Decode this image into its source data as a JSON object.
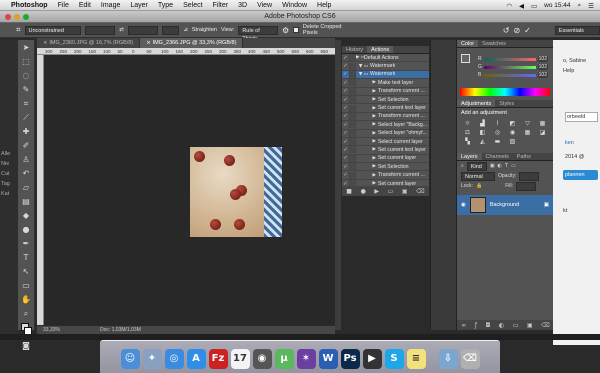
{
  "menubar": {
    "app": "Photoshop",
    "items": [
      "File",
      "Edit",
      "Image",
      "Layer",
      "Type",
      "Select",
      "Filter",
      "3D",
      "View",
      "Window",
      "Help"
    ],
    "clock": "wo 15:44",
    "user": "Sabine"
  },
  "window": {
    "title": "Adobe Photoshop CS6"
  },
  "options": {
    "ratio": "Unconstrained",
    "straighten": "Straighten",
    "view_label": "View:",
    "view_value": "Rule of Thirds",
    "delete_label": "Delete Cropped Pixels",
    "workspace": "Essentials"
  },
  "tabs": [
    {
      "label": "IMG_2360.JPG @ 16,7% (RGB/8)"
    },
    {
      "label": "IMG_2366.JPG @ 33,3% (RGB/8)"
    }
  ],
  "ruler": {
    "ticks": [
      "300",
      "250",
      "200",
      "150",
      "100",
      "50",
      "0",
      "50",
      "100",
      "150",
      "200",
      "250",
      "300",
      "350",
      "400",
      "450",
      "500",
      "550",
      "600",
      "650"
    ]
  },
  "status": {
    "zoom": "33,33%",
    "doc": "Doc: 1,03M/1,03M"
  },
  "actions_panel": {
    "tabs": [
      "History",
      "Actions"
    ],
    "rows": [
      "Default Actions",
      "Watermark",
      "Watermark",
      "Make text layer",
      "Transform current ...",
      "Set Selection",
      "Set current text layer",
      "Transform current ...",
      "Select layer \"Backg...",
      "Select layer \"ohmyf...",
      "Select current layer",
      "Set current text layer",
      "Set current layer",
      "Set Selection",
      "Transform current ...",
      "Set current layer"
    ]
  },
  "color_panel": {
    "tabs": [
      "Color",
      "Swatches"
    ],
    "channels": [
      {
        "label": "R",
        "value": "102"
      },
      {
        "label": "G",
        "value": "102"
      },
      {
        "label": "B",
        "value": "102"
      }
    ]
  },
  "adjust_panel": {
    "tabs": [
      "Adjustments",
      "Styles"
    ],
    "hint": "Add an adjustment"
  },
  "layers_panel": {
    "tabs": [
      "Layers",
      "Channels",
      "Paths"
    ],
    "kind": "Kind",
    "mode": "Normal",
    "opacity_label": "Opacity:",
    "lock_label": "Lock:",
    "fill_label": "Fill:",
    "layer_name": "Background"
  },
  "webpage": {
    "title": "o, Sabine",
    "menu": "Help",
    "button": "orbeeld",
    "link": "ken",
    "date": "2014 @",
    "plan": "plannen",
    "extra": "kt"
  },
  "desktop_left": {
    "items": [
      "Alle",
      "Nie",
      "Cat",
      "Tag",
      "Kat"
    ]
  },
  "dock": {
    "apps": [
      {
        "name": "Finder",
        "color": "#4a8fd8",
        "glyph": "☺"
      },
      {
        "name": "Launchpad",
        "color": "#8aa0c0",
        "glyph": "✦"
      },
      {
        "name": "Safari",
        "color": "#3b8be0",
        "glyph": "◎"
      },
      {
        "name": "App Store",
        "color": "#2f8ee8",
        "glyph": "A"
      },
      {
        "name": "FileZilla",
        "color": "#c22",
        "glyph": "Fz"
      },
      {
        "name": "Calendar",
        "color": "#f4f4f4",
        "glyph": "17"
      },
      {
        "name": "Photo Booth",
        "color": "#555",
        "glyph": "◉"
      },
      {
        "name": "uTorrent",
        "color": "#5cb85c",
        "glyph": "µ"
      },
      {
        "name": "iMovie",
        "color": "#6a3fa0",
        "glyph": "✶"
      },
      {
        "name": "Word",
        "color": "#2b5fb4",
        "glyph": "W"
      },
      {
        "name": "Photoshop",
        "color": "#0b2a4a",
        "glyph": "Ps"
      },
      {
        "name": "Final Cut",
        "color": "#333",
        "glyph": "▶"
      },
      {
        "name": "Skype",
        "color": "#1ea7e8",
        "glyph": "S"
      },
      {
        "name": "Stickies",
        "color": "#f3e27b",
        "glyph": "≡"
      },
      {
        "name": "Downloads",
        "color": "#7aa6cf",
        "glyph": "⇩"
      },
      {
        "name": "Trash",
        "color": "#b0b0b0",
        "glyph": "⌫"
      }
    ]
  }
}
